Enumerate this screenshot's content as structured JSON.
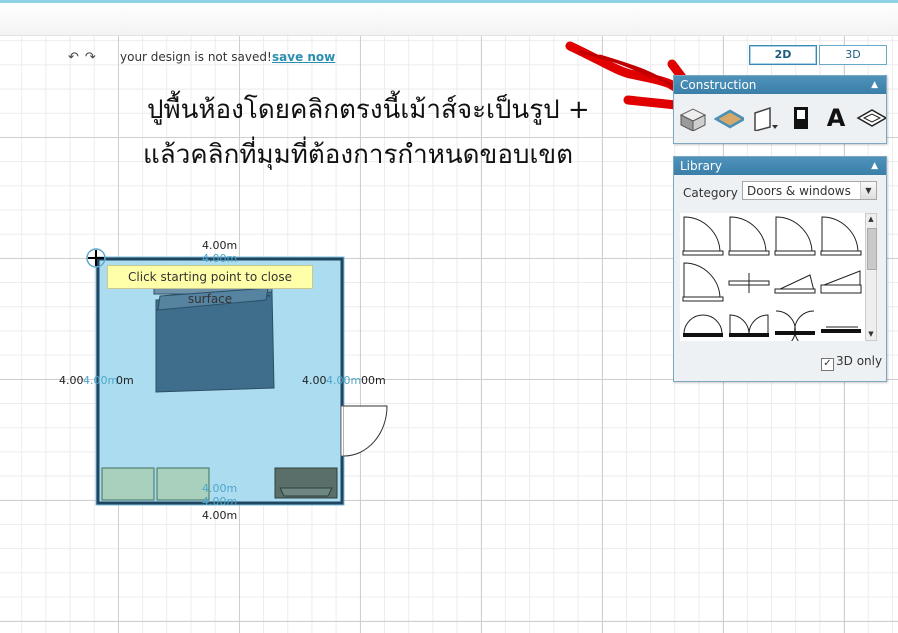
{
  "toolbar": {
    "undo_icon": "↶",
    "redo_icon": "↷",
    "status_message": "your design is not saved!",
    "save_link": "save now"
  },
  "view_toggle": {
    "option_2d": "2D",
    "option_3d": "3D",
    "selected": "2D"
  },
  "annotation": {
    "line1": "ปูพื้นห้องโดยคลิกตรงนี้เม้าส์จะเป็นรูป +",
    "line2": "แล้วคลิกที่มุมที่ต้องการกำหนดขอบเขต",
    "arrow_color": "#e00000"
  },
  "construction_panel": {
    "title": "Construction",
    "tools": [
      "wall-3d-icon",
      "floor-icon",
      "door-window-icon",
      "door-icon",
      "text-icon",
      "surface-icon"
    ],
    "text_tool_glyph": "A"
  },
  "library_panel": {
    "title": "Library",
    "category_label": "Category",
    "category_value": "Doors & windows",
    "only_3d_label": "3D only",
    "only_3d_checked": true
  },
  "plan": {
    "tooltip": "Click starting point to close surface",
    "dim_top": "4.00m",
    "dim_top_blue": "4.00m",
    "dim_bottom_blue_1": "4.00m",
    "dim_bottom_blue_2": "4.00m",
    "dim_bottom": "4.00m",
    "dim_left": "4.00",
    "dim_left_blue": "4.00m",
    "dim_left_tail": "0m",
    "dim_right": "4.00",
    "dim_right_blue": "4.00m",
    "dim_right_tail": "00m",
    "floor_color": "#acdcf0",
    "wall_color": "#1a1a1a"
  }
}
